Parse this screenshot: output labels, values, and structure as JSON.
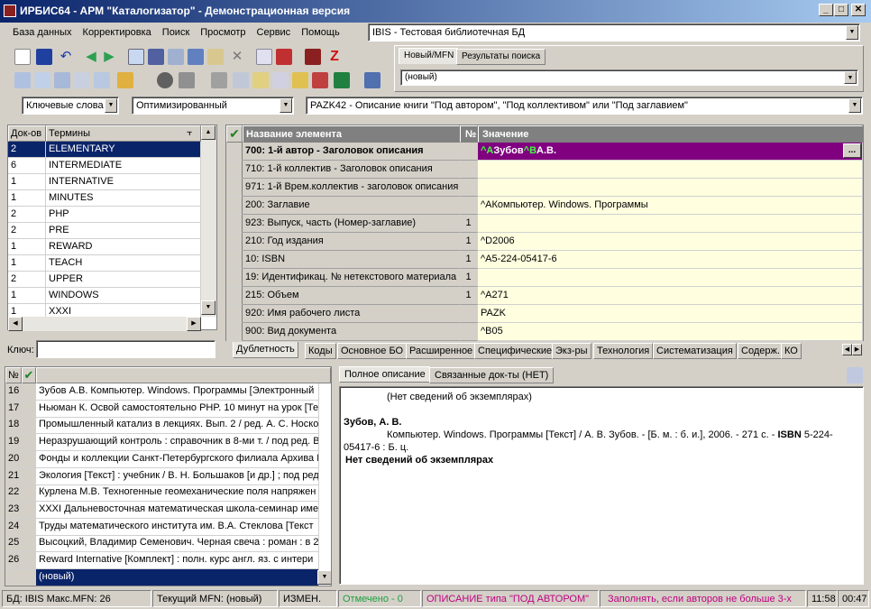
{
  "window": {
    "title": "ИРБИС64 - АРМ \"Каталогизатор\" - Демонстрационная версия",
    "min": "_",
    "max": "□",
    "close": "✕"
  },
  "menu": [
    "База данных",
    "Корректировка",
    "Поиск",
    "Просмотр",
    "Сервис",
    "Помощь"
  ],
  "db_combo": "IBIS - Тестовая библиотечная БД",
  "top_tabs": [
    "Новый/MFN",
    "Результаты поиска"
  ],
  "new_combo": "(новый)",
  "dict_mode": "Ключевые слова",
  "optimize": "Оптимизированный",
  "worksheet": "PAZK42 - Описание книги \"Под автором\", \"Под коллективом\" или \"Под заглавием\"",
  "dict": {
    "col_docs": "Док-ов",
    "col_terms": "Термины",
    "rows": [
      [
        "2",
        "ELEMENTARY"
      ],
      [
        "6",
        "INTERMEDIATE"
      ],
      [
        "1",
        "INTERNATIVE"
      ],
      [
        "1",
        "MINUTES"
      ],
      [
        "2",
        "PHP"
      ],
      [
        "2",
        "PRE"
      ],
      [
        "1",
        "REWARD"
      ],
      [
        "1",
        "TEACH"
      ],
      [
        "2",
        "UPPER"
      ],
      [
        "1",
        "WINDOWS"
      ],
      [
        "1",
        "XXXI"
      ]
    ],
    "key_label": "Ключ:",
    "key_value": ""
  },
  "editor": {
    "col_name": "Название элемента",
    "col_no": "№",
    "col_value": "Значение",
    "ellipsis": "...",
    "rows": [
      {
        "name": "700: 1-й  автор - Заголовок описания",
        "no": "",
        "value": "^AЗубов^BА.В."
      },
      {
        "name": "710: 1-й коллектив - Заголовок описания",
        "no": "",
        "value": ""
      },
      {
        "name": "971: 1-й Врем.коллектив - заголовок описания",
        "no": "",
        "value": ""
      },
      {
        "name": "200: Заглавие",
        "no": "",
        "value": "^AКомпьютер. Windows. Программы"
      },
      {
        "name": "923: Выпуск, часть (Номер-заглавие)",
        "no": "1",
        "value": ""
      },
      {
        "name": "210: Год издания",
        "no": "1",
        "value": "^D2006"
      },
      {
        "name": "10: ISBN",
        "no": "1",
        "value": "^A5-224-05417-6"
      },
      {
        "name": "19: Идентификац. № нетекстового материала",
        "no": "1",
        "value": ""
      },
      {
        "name": "215: Объем",
        "no": "1",
        "value": "^A271"
      },
      {
        "name": "920: Имя рабочего листа",
        "no": "",
        "value": "PAZK"
      },
      {
        "name": "900: Вид документа",
        "no": "",
        "value": "^B05"
      }
    ],
    "value_parts": {
      "a": "^A",
      "b": "Зубов",
      "c": "^B",
      "d": "А.В."
    }
  },
  "editor_tabs": [
    "Дублетность",
    "Коды",
    "Основное БО",
    "Расширенное",
    "Специфические",
    "Экз-ры",
    "Технология",
    "Систематизация",
    "Содерж.",
    "КО"
  ],
  "records": {
    "col_no": "№",
    "col_mark": "✔",
    "rows": [
      [
        "16",
        "Зубов А.В. Компьютер. Windows. Программы [Электронный"
      ],
      [
        "17",
        "Ньюман К. Освой самостоятельно PHP. 10 минут на урок [Те"
      ],
      [
        "18",
        "Промышленный катализ в лекциях. Вып. 2 / ред. А. С. Носко"
      ],
      [
        "19",
        "Неразрушающий контроль : справочник в 8-ми т. / под ред. В"
      ],
      [
        "20",
        "Фонды и коллекции Санкт-Петербургского филиала Архива Р"
      ],
      [
        "21",
        "Экология [Текст] : учебник / В. Н. Большаков [и др.] ; под ред"
      ],
      [
        "22",
        "Курлена М.В. Техногенные геомеханические поля напряжен"
      ],
      [
        "23",
        "XXXI Дальневосточная математическая школа-семинар име"
      ],
      [
        "24",
        "Труды математического института им. В.А. Стеклова [Текст"
      ],
      [
        "25",
        "Высоцкий, Владимир Семенович. Черная свеча : роман : в 2"
      ],
      [
        "26",
        "Reward Internative [Комплект] : полн. курс англ. яз. с интери"
      ]
    ],
    "new_row": "(новый)"
  },
  "desc_tabs": [
    "Полное описание",
    "Связанные док-ты (НЕТ)"
  ],
  "desc": {
    "line1": "(Нет сведений об экземплярах)",
    "author": "Зубов, А. В.",
    "body": "Компьютер. Windows. Программы [Текст] / А. В. Зубов. - [Б. м. : б. и.], 2006. - 271 с. - ",
    "isbn_label": "ISBN",
    "isbn_rest": " 5-224-05417-6 : Б. ц.",
    "bold_line": "Нет сведений об экземплярах"
  },
  "status": {
    "db": "БД: IBIS Макс.MFN: 26",
    "cur": "Текущий MFN: (новый)",
    "mod": "ИЗМЕН.",
    "marked": "Отмечено - 0",
    "desc_type": "ОПИСАНИЕ типа \"ПОД АВТОРОМ\"",
    "hint": "Заполнять, если авторов не больше 3-х",
    "time1": "11:58",
    "time2": "00:47"
  }
}
